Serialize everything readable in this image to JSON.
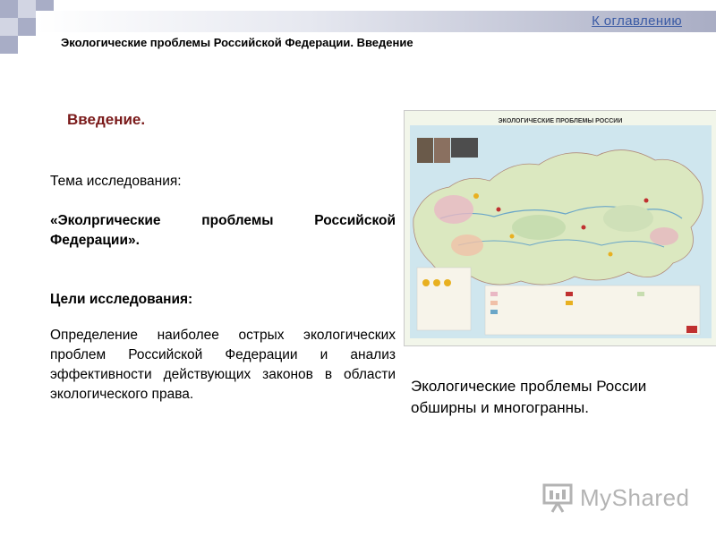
{
  "nav": {
    "toc_link": "К оглавлению"
  },
  "header": {
    "title": "Экологические проблемы Российской Федерации. Введение"
  },
  "slide": {
    "heading": "Введение.",
    "topic_label": "Тема исследования:",
    "topic_value": "«Эколргические проблемы Российской Федерации».",
    "goals_label": "Цели исследования:",
    "goals_text": "Определение наиболее острых экологических проблем Российской Федерации и анализ эффективности действующих законов в области экологического права.",
    "caption": "Экологические проблемы России обширны и многогранны."
  },
  "map": {
    "title": "ЭКОЛОГИЧЕСКИЕ ПРОБЛЕМЫ РОССИИ"
  },
  "watermark": {
    "text": "MyShared"
  },
  "colors": {
    "heading": "#7a1a1a",
    "link": "#3b5ba5",
    "deco_square": "#9da2bf"
  }
}
